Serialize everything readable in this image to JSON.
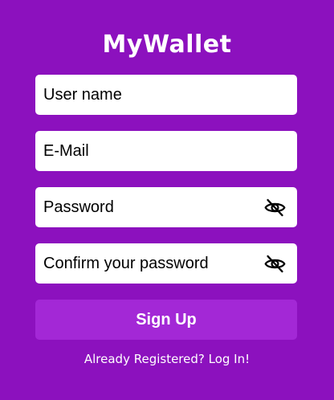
{
  "app": {
    "title": "MyWallet"
  },
  "form": {
    "username": {
      "placeholder": "User name",
      "value": ""
    },
    "email": {
      "placeholder": "E-Mail",
      "value": ""
    },
    "password": {
      "placeholder": "Password",
      "value": "",
      "icon": "eye-off-icon"
    },
    "confirm_password": {
      "placeholder": "Confirm your password",
      "value": "",
      "icon": "eye-off-icon"
    },
    "submit_label": "Sign Up"
  },
  "footer": {
    "login_link": "Already Registered? Log In!"
  },
  "colors": {
    "background": "#8C11BE",
    "button": "#A328D6",
    "input_background": "#FFFFFF",
    "text_light": "#FFFFFF"
  }
}
